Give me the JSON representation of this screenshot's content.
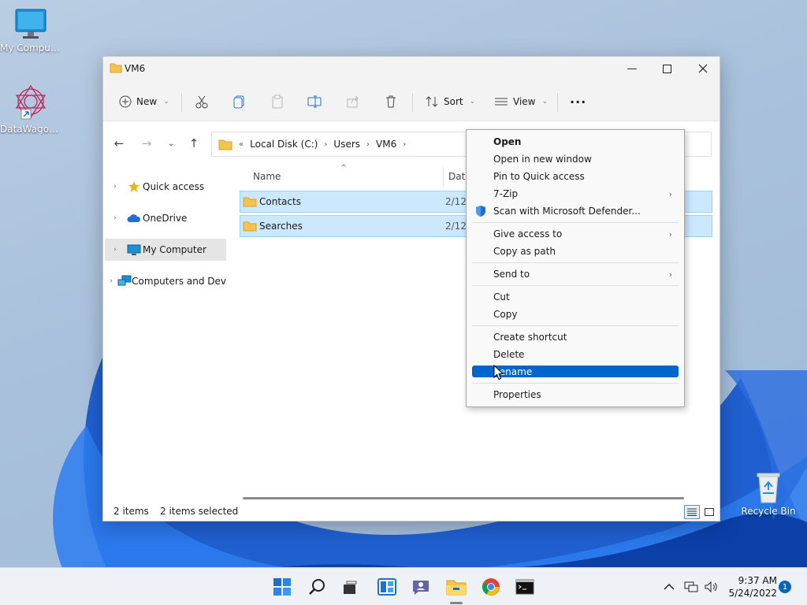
{
  "desktop": {
    "icons": [
      {
        "label": "My Computer"
      },
      {
        "label": "DataWagon..."
      },
      {
        "label": "Recycle Bin"
      }
    ]
  },
  "window": {
    "title": "VM6",
    "toolbar": {
      "new_label": "New",
      "sort_label": "Sort",
      "view_label": "View",
      "more_label": "···"
    },
    "breadcrumb": {
      "overflow": "«",
      "parts": [
        "Local Disk (C:)",
        "Users",
        "VM6"
      ]
    },
    "nav_pane": {
      "items": [
        {
          "label": "Quick access"
        },
        {
          "label": "OneDrive"
        },
        {
          "label": "My Computer"
        },
        {
          "label": "Computers and Dev"
        }
      ]
    },
    "columns": {
      "name": "Name",
      "date": "Date"
    },
    "rows": [
      {
        "name": "Contacts",
        "date": "2/12"
      },
      {
        "name": "Searches",
        "date": "2/12"
      }
    ],
    "status": {
      "count": "2 items",
      "selected": "2 items selected"
    }
  },
  "context_menu": {
    "items": [
      {
        "label": "Open"
      },
      {
        "label": "Open in new window"
      },
      {
        "label": "Pin to Quick access"
      },
      {
        "label": "7-Zip"
      },
      {
        "label": "Scan with Microsoft Defender..."
      },
      {
        "label": "Give access to"
      },
      {
        "label": "Copy as path"
      },
      {
        "label": "Send to"
      },
      {
        "label": "Cut"
      },
      {
        "label": "Copy"
      },
      {
        "label": "Create shortcut"
      },
      {
        "label": "Delete"
      },
      {
        "label": "Rename"
      },
      {
        "label": "Properties"
      }
    ],
    "highlight_color": "#0066cc"
  },
  "taskbar": {
    "time": "9:37 AM",
    "date": "5/24/2022",
    "notifications": "1",
    "accent": "#0067c0"
  }
}
